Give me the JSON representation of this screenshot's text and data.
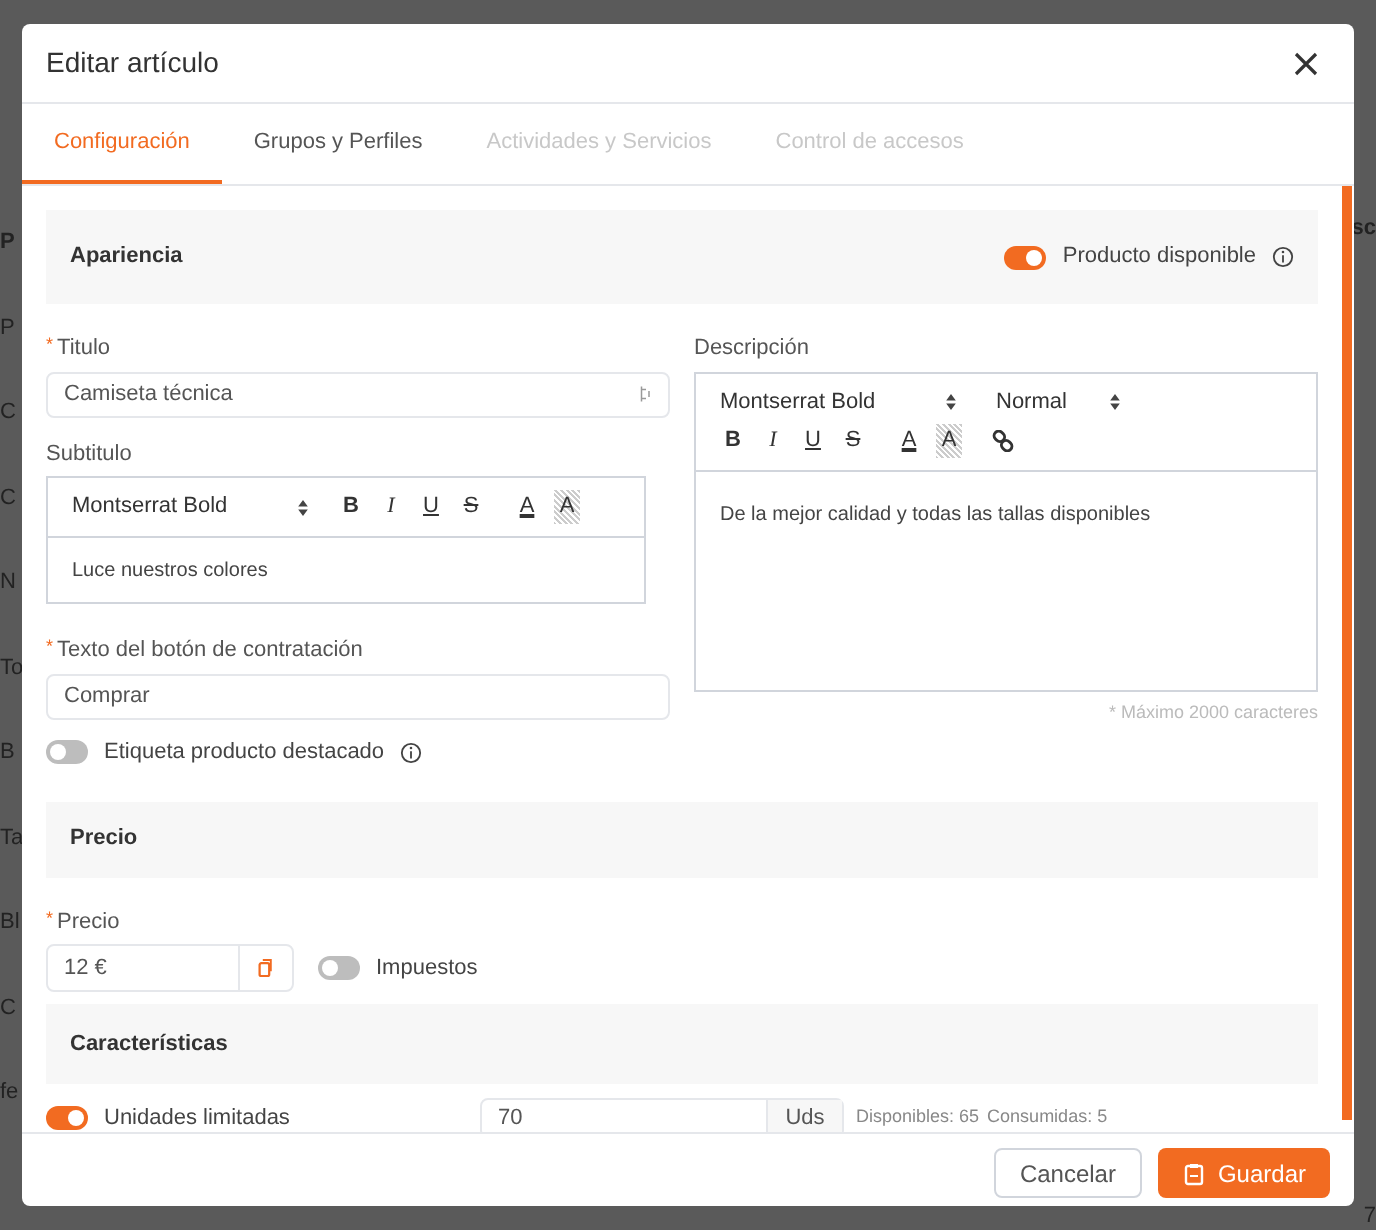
{
  "background": {
    "left_column": [
      "P",
      "P",
      "C",
      "C",
      "N",
      "To",
      "B",
      "Ta",
      "Bl",
      "C",
      "fe"
    ],
    "right_column": [
      "sc",
      "7"
    ]
  },
  "dialog": {
    "title": "Editar artículo"
  },
  "tabs": [
    {
      "label": "Configuración",
      "selected": true,
      "disabled": false
    },
    {
      "label": "Grupos y Perfiles",
      "selected": false,
      "disabled": false
    },
    {
      "label": "Actividades y Servicios",
      "selected": false,
      "disabled": true
    },
    {
      "label": "Control de accesos",
      "selected": false,
      "disabled": true
    }
  ],
  "apariencia": {
    "heading": "Apariencia",
    "toggle": {
      "label": "Producto disponible",
      "on": true
    }
  },
  "titulo": {
    "label": "Titulo",
    "required_mark": "*",
    "value": "Camiseta técnica"
  },
  "subtitulo": {
    "label": "Subtitulo",
    "font": "Montserrat Bold",
    "toolbar": [
      {
        "kind": "bold",
        "glyph": "B"
      },
      {
        "kind": "italic",
        "glyph": "I"
      },
      {
        "kind": "underline",
        "glyph": "U"
      },
      {
        "kind": "strike",
        "glyph": "S"
      },
      {
        "kind": "color",
        "glyph": "A"
      },
      {
        "kind": "background",
        "glyph": "A"
      }
    ],
    "text": "Luce nuestros colores"
  },
  "boton": {
    "label": "Texto del botón de contratación",
    "required_mark": "*",
    "value": "Comprar"
  },
  "destacado": {
    "label": "Etiqueta producto destacado",
    "on": false
  },
  "descripcion": {
    "label": "Descripción",
    "font": "Montserrat Bold",
    "size": "Normal",
    "toolbar": [
      {
        "kind": "bold",
        "glyph": "B"
      },
      {
        "kind": "italic",
        "glyph": "I"
      },
      {
        "kind": "underline",
        "glyph": "U"
      },
      {
        "kind": "strike",
        "glyph": "S"
      },
      {
        "kind": "color",
        "glyph": "A"
      },
      {
        "kind": "background",
        "glyph": "A"
      },
      {
        "kind": "link"
      }
    ],
    "text": "De la mejor calidad y todas las tallas disponibles",
    "hint": "* Máximo 2000 caracteres"
  },
  "precio": {
    "heading": "Precio",
    "label": "Precio",
    "required_mark": "*",
    "value": "12 €",
    "toggle": {
      "label": "Impuestos",
      "on": false
    }
  },
  "caracteristicas": {
    "heading": "Características",
    "toggle": {
      "label": "Unidades limitadas",
      "on": true
    },
    "value": "70",
    "unit": "Uds",
    "available": "Disponibles: 65",
    "consumed": "Consumidas: 5"
  },
  "footer": {
    "cancel": "Cancelar",
    "save": "Guardar"
  }
}
